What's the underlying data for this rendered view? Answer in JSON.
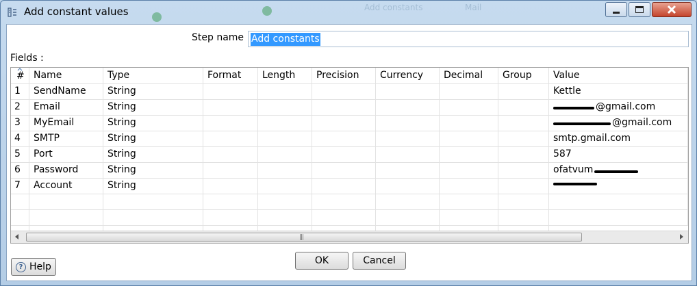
{
  "window": {
    "title": "Add constant values",
    "background_tabs": [
      "Add constants",
      "Mail"
    ]
  },
  "step_name": {
    "label": "Step name",
    "value": "Add constants"
  },
  "fields": {
    "label": "Fields :",
    "columns": [
      "#",
      "Name",
      "Type",
      "Format",
      "Length",
      "Precision",
      "Currency",
      "Decimal",
      "Group",
      "Value"
    ],
    "rows": [
      {
        "num": "1",
        "name": "SendName",
        "type": "String",
        "value": "Kettle"
      },
      {
        "num": "2",
        "name": "Email",
        "type": "String",
        "value": "@gmail.com"
      },
      {
        "num": "3",
        "name": "MyEmail",
        "type": "String",
        "value": "@gmail.com"
      },
      {
        "num": "4",
        "name": "SMTP",
        "type": "String",
        "value": "smtp.gmail.com"
      },
      {
        "num": "5",
        "name": "Port",
        "type": "String",
        "value": "587"
      },
      {
        "num": "6",
        "name": "Password",
        "type": "String",
        "value": "ofatvum"
      },
      {
        "num": "7",
        "name": "Account",
        "type": "String",
        "value": ""
      }
    ]
  },
  "buttons": {
    "help": "Help",
    "ok": "OK",
    "cancel": "Cancel"
  },
  "colors": {
    "selection": "#3399ff",
    "title_bg": "#c6dbef",
    "close_button": "#c4442c"
  },
  "icons": {
    "title": "step-icon",
    "help": "help-icon",
    "minimize": "minimize-icon",
    "maximize": "maximize-icon",
    "close": "close-icon"
  }
}
